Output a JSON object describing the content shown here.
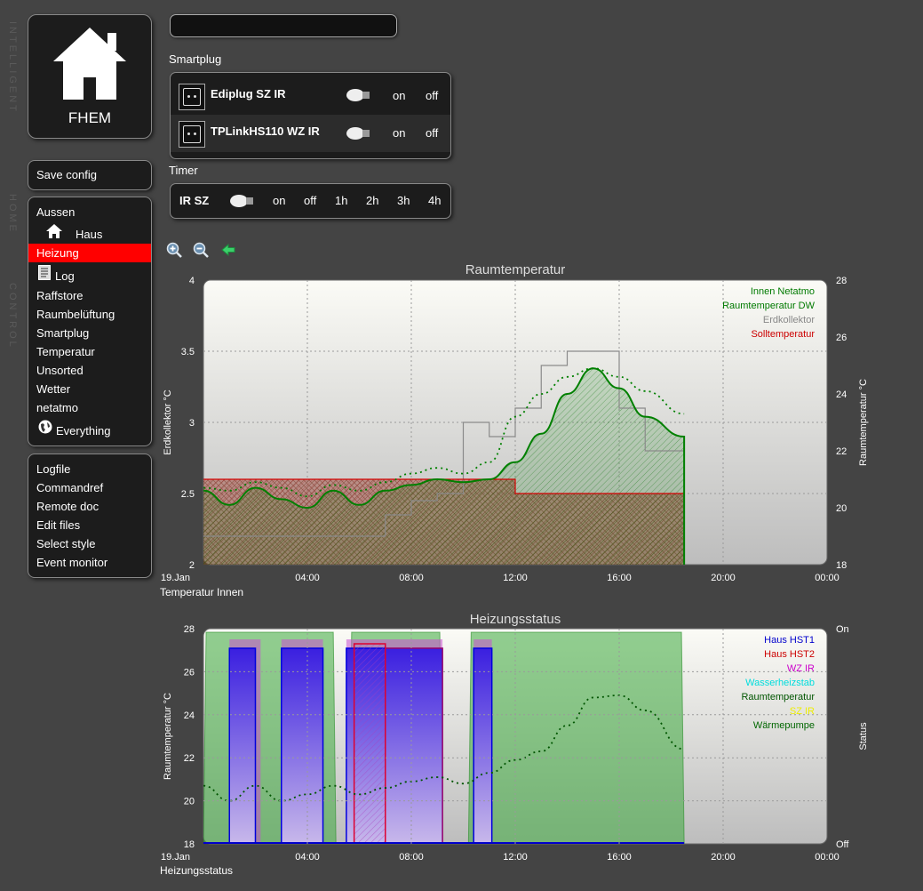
{
  "sidebar": {
    "vertical_text": [
      "INTELLIGENT",
      "HOME",
      "CONTROL"
    ],
    "logo_text": "FHEM",
    "save_config": "Save config",
    "rooms": [
      "Aussen",
      "Haus",
      "Heizung",
      "Log",
      "Raffstore",
      "Raumbelüftung",
      "Smartplug",
      "Temperatur",
      "Unsorted",
      "Wetter",
      "netatmo",
      "Everything"
    ],
    "selected_room": "Heizung",
    "tools": [
      "Logfile",
      "Commandref",
      "Remote doc",
      "Edit files",
      "Select style",
      "Event monitor"
    ]
  },
  "search": {
    "value": ""
  },
  "groups": {
    "smartplug": {
      "label": "Smartplug",
      "devices": [
        {
          "name": "Ediplug SZ IR",
          "on": "on",
          "off": "off"
        },
        {
          "name": "TPLinkHS110 WZ IR",
          "on": "on",
          "off": "off"
        }
      ]
    },
    "timer": {
      "label": "Timer",
      "device": "IR SZ",
      "commands": [
        "on",
        "off",
        "1h",
        "2h",
        "3h",
        "4h"
      ]
    }
  },
  "chart1": {
    "title": "Raumtemperatur",
    "footer": "Temperatur Innen",
    "ylabel_left": "Erdkollektor °C",
    "ylabel_right": "Raumtemperatur °C",
    "x_ticks": [
      "19.Jan",
      "04:00",
      "08:00",
      "12:00",
      "16:00",
      "20:00",
      "00:00"
    ],
    "y_left_ticks": [
      "4",
      "3.5",
      "3",
      "2.5",
      "2"
    ],
    "y_right_ticks": [
      "28",
      "26",
      "24",
      "22",
      "20",
      "18"
    ],
    "legend": [
      {
        "label": "Innen Netatmo",
        "color": "#007a00"
      },
      {
        "label": "Raumtemperatur DW",
        "color": "#007a00"
      },
      {
        "label": "Erdkollektor",
        "color": "#888888"
      },
      {
        "label": "Solltemperatur",
        "color": "#cc0000"
      }
    ]
  },
  "chart2": {
    "title": "Heizungsstatus",
    "footer": "Heizungsstatus",
    "ylabel_left": "Raumtemperatur °C",
    "ylabel_right": "Status",
    "x_ticks": [
      "19.Jan",
      "04:00",
      "08:00",
      "12:00",
      "16:00",
      "20:00",
      "00:00"
    ],
    "y_left_ticks": [
      "28",
      "26",
      "24",
      "22",
      "20",
      "18"
    ],
    "y_right_ticks": [
      "On",
      "Off"
    ],
    "legend": [
      {
        "label": "Haus HST1",
        "color": "#0000cc"
      },
      {
        "label": "Haus HST2",
        "color": "#cc0000"
      },
      {
        "label": "WZ IR",
        "color": "#cc00cc"
      },
      {
        "label": "Wasserheizstab",
        "color": "#00dddd"
      },
      {
        "label": "Raumtemperatur",
        "color": "#005500"
      },
      {
        "label": "SZ IR",
        "color": "#eeee00"
      },
      {
        "label": "Wärmepumpe",
        "color": "#006600"
      }
    ]
  },
  "chart_data": [
    {
      "type": "line",
      "title": "Raumtemperatur",
      "xlabel": "Temperatur Innen",
      "ylabel": "Erdkollektor °C",
      "ylabel_right": "Raumtemperatur °C",
      "xlim": [
        "19.Jan 00:00",
        "20.Jan 00:00"
      ],
      "ylim": [
        2,
        4
      ],
      "ylim_right": [
        18,
        28
      ],
      "grid": true,
      "legend_position": "top-right",
      "x_hours": [
        0,
        1,
        2,
        3,
        4,
        5,
        6,
        7,
        8,
        9,
        10,
        11,
        12,
        13,
        14,
        15,
        16,
        17,
        18.5
      ],
      "series": [
        {
          "name": "Innen Netatmo",
          "axis": "right",
          "values": [
            20.7,
            20.6,
            20.9,
            20.7,
            20.4,
            20.8,
            20.6,
            20.9,
            21.2,
            21.4,
            21.2,
            21.6,
            23.2,
            24.0,
            24.6,
            24.9,
            24.6,
            24.1,
            23.3
          ]
        },
        {
          "name": "Raumtemperatur DW",
          "axis": "right",
          "values": [
            20.6,
            20.1,
            20.7,
            20.3,
            20.0,
            20.6,
            20.1,
            20.6,
            20.8,
            21.0,
            20.9,
            21.0,
            21.6,
            22.6,
            24.0,
            24.9,
            24.2,
            23.2,
            22.5
          ]
        },
        {
          "name": "Erdkollektor",
          "axis": "left",
          "values": [
            2.2,
            2.2,
            2.2,
            2.2,
            2.2,
            2.2,
            2.2,
            2.35,
            2.45,
            2.5,
            3.0,
            2.9,
            3.1,
            3.4,
            3.5,
            3.5,
            3.1,
            2.8,
            2.45
          ]
        },
        {
          "name": "Solltemperatur",
          "axis": "right",
          "values": [
            21.0,
            21.0,
            21.0,
            21.0,
            21.0,
            21.0,
            21.0,
            21.0,
            21.0,
            21.0,
            21.0,
            21.0,
            20.5,
            20.5,
            20.5,
            20.5,
            20.5,
            20.5,
            21.0
          ]
        }
      ]
    },
    {
      "type": "area",
      "title": "Heizungsstatus",
      "xlabel": "Heizungsstatus",
      "ylabel": "Raumtemperatur °C",
      "ylabel_right": "Status",
      "xlim": [
        "19.Jan 00:00",
        "20.Jan 00:00"
      ],
      "ylim": [
        18,
        28
      ],
      "ylim_right": [
        "Off",
        "On"
      ],
      "grid": true,
      "legend_position": "top-right",
      "status_intervals": [
        {
          "name": "Wärmepumpe",
          "on": [
            [
              0,
              5.1
            ],
            [
              5.6,
              9.2
            ],
            [
              10.2,
              18.5
            ]
          ]
        },
        {
          "name": "Haus HST1",
          "on": [
            [
              1.0,
              2.0
            ],
            [
              3.0,
              4.6
            ],
            [
              5.5,
              9.2
            ],
            [
              10.4,
              11.1
            ]
          ]
        },
        {
          "name": "Haus HST2",
          "on": [
            [
              5.8,
              7.0
            ],
            [
              7.0,
              9.2
            ]
          ]
        },
        {
          "name": "WZ IR",
          "on": [
            [
              1.0,
              2.2
            ],
            [
              3.0,
              4.6
            ],
            [
              5.5,
              9.2
            ],
            [
              10.4,
              11.1
            ]
          ]
        }
      ],
      "series": [
        {
          "name": "Raumtemperatur",
          "x_hours": [
            0,
            1,
            2,
            3,
            4,
            5,
            6,
            7,
            8,
            9,
            10,
            11,
            12,
            13,
            14,
            15,
            16,
            17,
            18.5
          ],
          "values": [
            20.7,
            20.0,
            20.7,
            20.0,
            20.3,
            20.7,
            20.3,
            20.6,
            20.9,
            21.1,
            20.8,
            21.3,
            21.9,
            22.3,
            23.5,
            24.8,
            24.9,
            24.2,
            22.4
          ]
        }
      ]
    }
  ]
}
